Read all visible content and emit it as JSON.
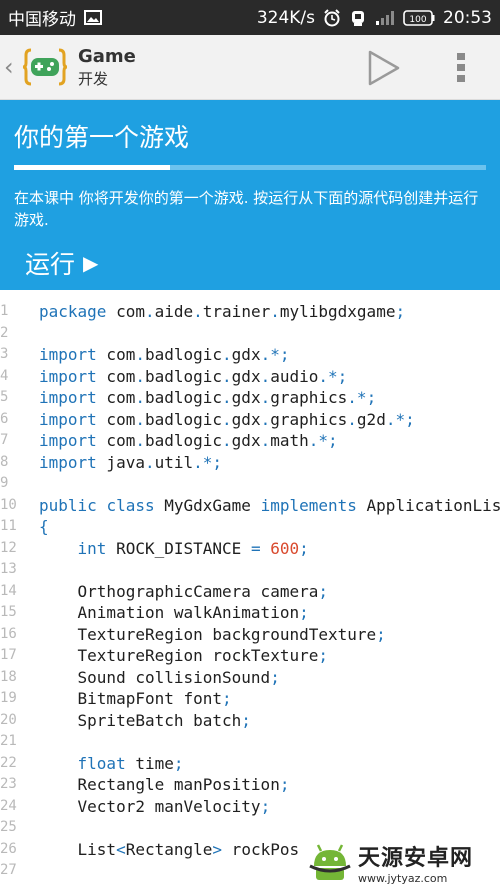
{
  "status_bar": {
    "carrier": "中国移动",
    "speed": "324K/s",
    "battery_label": "100",
    "time": "20:53"
  },
  "app_bar": {
    "title": "Game",
    "subtitle": "开发"
  },
  "lesson": {
    "title": "你的第一个游戏",
    "progress_fraction": 0.33,
    "description": "在本课中 你将开发你的第一个游戏. 按运行从下面的源代码创建并运行游戏.",
    "run_label": "运行"
  },
  "code_lines": [
    {
      "num": "1",
      "text": "package com.aide.trainer.mylibgdxgame;"
    },
    {
      "num": "2",
      "text": ""
    },
    {
      "num": "3",
      "text": "import com.badlogic.gdx.*;"
    },
    {
      "num": "4",
      "text": "import com.badlogic.gdx.audio.*;"
    },
    {
      "num": "5",
      "text": "import com.badlogic.gdx.graphics.*;"
    },
    {
      "num": "6",
      "text": "import com.badlogic.gdx.graphics.g2d.*;"
    },
    {
      "num": "7",
      "text": "import com.badlogic.gdx.math.*;"
    },
    {
      "num": "8",
      "text": "import java.util.*;"
    },
    {
      "num": "9",
      "text": ""
    },
    {
      "num": "10",
      "text": "public class MyGdxGame implements ApplicationLis"
    },
    {
      "num": "11",
      "text": "{"
    },
    {
      "num": "12",
      "text": "    int ROCK_DISTANCE = 600;"
    },
    {
      "num": "13",
      "text": ""
    },
    {
      "num": "14",
      "text": "    OrthographicCamera camera;"
    },
    {
      "num": "15",
      "text": "    Animation walkAnimation;"
    },
    {
      "num": "16",
      "text": "    TextureRegion backgroundTexture;"
    },
    {
      "num": "17",
      "text": "    TextureRegion rockTexture;"
    },
    {
      "num": "18",
      "text": "    Sound collisionSound;"
    },
    {
      "num": "19",
      "text": "    BitmapFont font;"
    },
    {
      "num": "20",
      "text": "    SpriteBatch batch;"
    },
    {
      "num": "21",
      "text": ""
    },
    {
      "num": "22",
      "text": "    float time;"
    },
    {
      "num": "23",
      "text": "    Rectangle manPosition;"
    },
    {
      "num": "24",
      "text": "    Vector2 manVelocity;"
    },
    {
      "num": "25",
      "text": ""
    },
    {
      "num": "26",
      "text": "    List<Rectangle> rockPos"
    },
    {
      "num": "27",
      "text": ""
    }
  ],
  "watermark": {
    "name": "天源安卓网",
    "url": "www.jytyaz.com"
  },
  "colors": {
    "status_bg": "#2a2a2a",
    "app_bar_bg": "#f2f2f2",
    "hero_bg": "#1fa0e1",
    "keyword": "#1f73b7",
    "number": "#d94a2e",
    "logo_green": "#3fa35a",
    "logo_bracket": "#e2a322"
  },
  "icons": {
    "status_left": [
      "image-icon"
    ],
    "status_right": [
      "alarm-icon",
      "notification-icon",
      "signal-icon",
      "battery-icon"
    ],
    "app_bar": [
      "back-chevron-icon",
      "gamepad-logo-icon",
      "play-icon",
      "more-vert-icon"
    ]
  }
}
